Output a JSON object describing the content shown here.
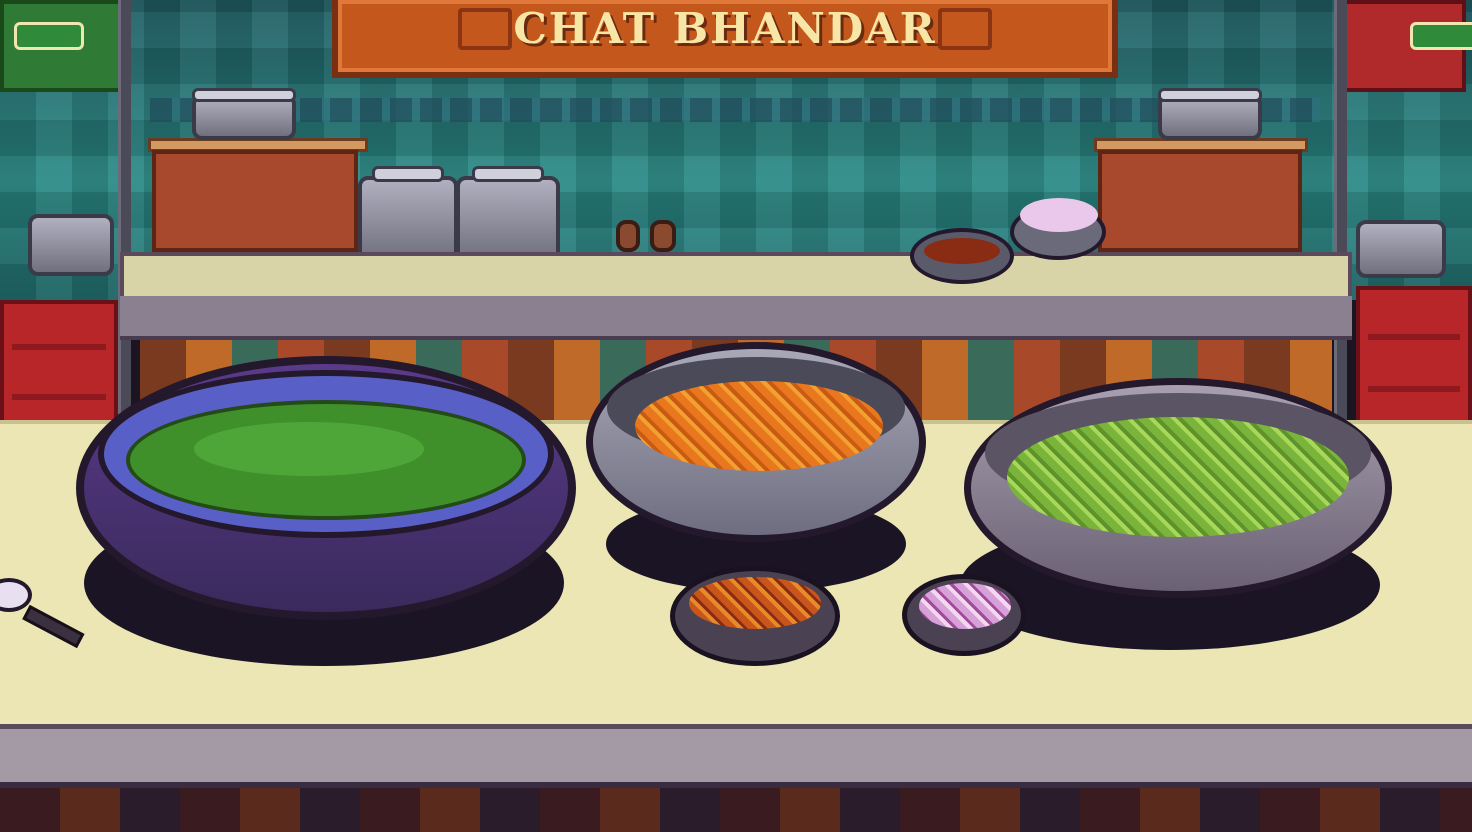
{
  "stall": {
    "sign_title": "CHAT BHANDAR"
  },
  "colors": {
    "wall": "#2a8a86",
    "sign": "#c4581c",
    "counter": "#ebe6b4",
    "green_chutney": "#3f8f2a",
    "orange_boondi": "#e8771e",
    "green_onion": "#7ab43a",
    "red_chutney": "#8a2c14",
    "purple_onion": "#d8a0d8"
  },
  "items": {
    "green_chutney_bowl": {
      "icon": "blue-bowl-green-chutney-icon"
    },
    "boondi_bowl": {
      "icon": "steel-bowl-orange-boondi-icon"
    },
    "chopped_greens_bowl": {
      "icon": "steel-bowl-chopped-greens-icon"
    },
    "small_spice_bowl": {
      "icon": "small-bowl-spice-icon"
    },
    "small_onion_bowl": {
      "icon": "small-bowl-purple-onion-icon"
    },
    "back_red_chutney_bowl": {
      "icon": "small-bowl-red-chutney-icon"
    },
    "back_onion_bowl": {
      "icon": "small-bowl-onion-icon"
    },
    "spoon": {
      "icon": "spoon-icon"
    },
    "kettles": {
      "icon": "kettle-icon"
    }
  }
}
